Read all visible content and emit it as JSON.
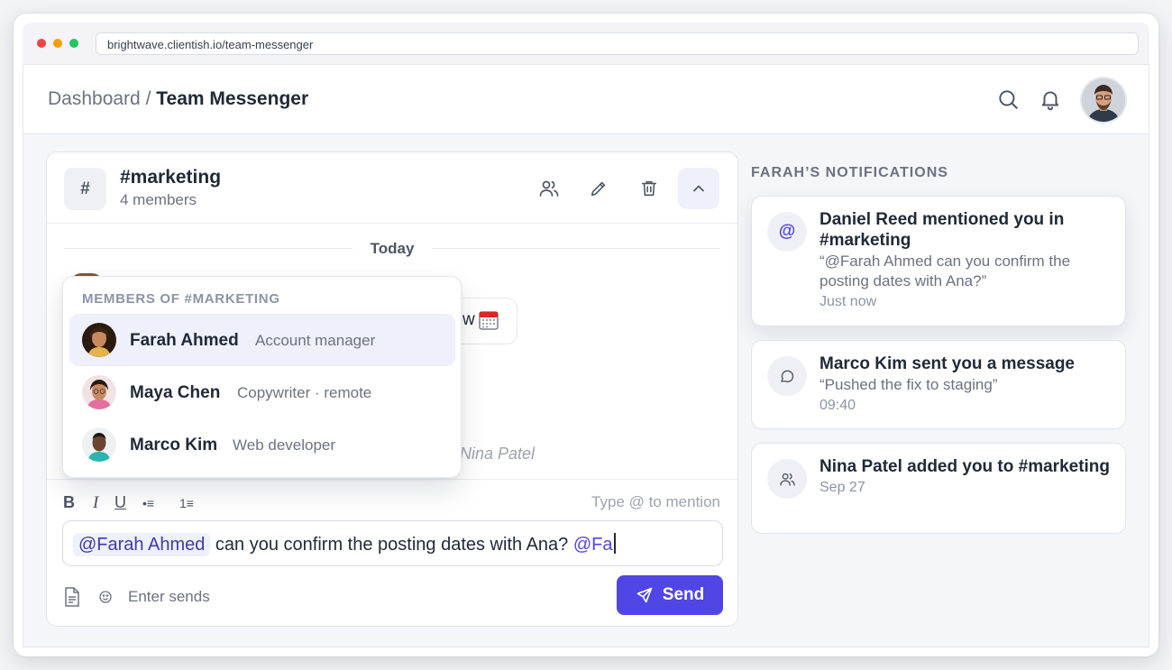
{
  "browser": {
    "url": "brightwave.clientish.io/team-messenger"
  },
  "header": {
    "breadcrumb_root": "Dashboard",
    "breadcrumb_separator": "/",
    "breadcrumb_current": "Team Messenger",
    "icons": [
      "search-icon",
      "bell-icon",
      "user-avatar"
    ]
  },
  "channel": {
    "hash": "#",
    "name": "#marketing",
    "members": "4 members",
    "actions": [
      "members-icon",
      "edit-icon",
      "trash-icon",
      "chevron-up-icon"
    ]
  },
  "messages": {
    "day_label": "Today",
    "bubble_tail": "w",
    "ghost_author": "Nina Patel"
  },
  "mention_popover": {
    "title": "MEMBERS OF #MARKETING",
    "members": [
      {
        "name": "Farah Ahmed",
        "role": "Account manager",
        "selected": true
      },
      {
        "name": "Maya Chen",
        "role": "Copywriter · remote",
        "selected": false
      },
      {
        "name": "Marco Kim",
        "role": "Web developer",
        "selected": false
      }
    ]
  },
  "composer": {
    "format_buttons": {
      "bold": "B",
      "italic": "I",
      "underline": "U",
      "bullets": "•≡",
      "numbered": "1≡"
    },
    "hint": "Type @ to mention",
    "mention_chip": "@Farah Ahmed",
    "text": " can you confirm the posting dates with Ana? ",
    "partial_mention": "@Fa",
    "enter_hint": "Enter sends",
    "send_label": "Send"
  },
  "notifications": {
    "title": "FARAH’S NOTIFICATIONS",
    "items": [
      {
        "icon": "at-icon",
        "headline": "Daniel Reed mentioned you in #marketing",
        "quote": "“@Farah Ahmed can you confirm the posting dates with Ana?”",
        "time": "Just now"
      },
      {
        "icon": "chat-icon",
        "headline": "Marco Kim sent you a message",
        "quote": "“Pushed the fix to staging”",
        "time": "09:40"
      },
      {
        "icon": "users-icon",
        "headline": "Nina Patel added you to #marketing",
        "quote": "",
        "time": "Sep 27"
      }
    ]
  },
  "colors": {
    "accent": "#4f46e5",
    "background": "#f5f6fa",
    "text": "#1f2937",
    "muted": "#6b7280"
  }
}
